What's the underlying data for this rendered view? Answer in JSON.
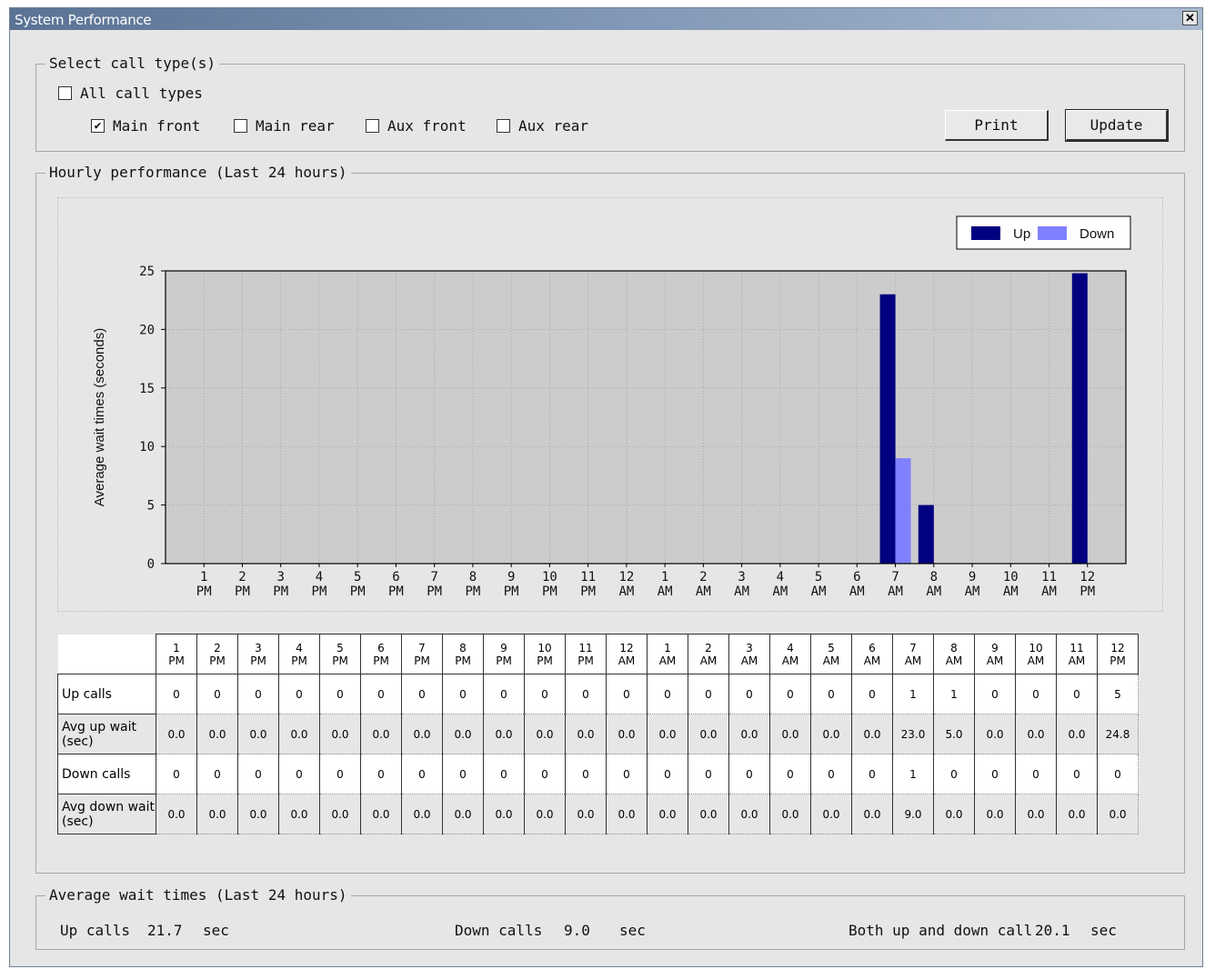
{
  "window": {
    "title": "System Performance",
    "close_glyph": "✕"
  },
  "call_types": {
    "legend": "Select call type(s)",
    "all": {
      "label": "All call types",
      "checked": false
    },
    "options": [
      {
        "label": "Main front",
        "checked": true
      },
      {
        "label": "Main rear",
        "checked": false
      },
      {
        "label": "Aux front",
        "checked": false
      },
      {
        "label": "Aux rear",
        "checked": false
      }
    ]
  },
  "buttons": {
    "print": "Print",
    "update": "Update"
  },
  "hourly": {
    "legend": "Hourly performance (Last 24 hours)"
  },
  "chart_data": {
    "type": "bar",
    "ylabel": "Average wait times (seconds)",
    "xlabel": "",
    "ylim": [
      0,
      25
    ],
    "yticks": [
      0,
      5,
      10,
      15,
      20,
      25
    ],
    "categories": [
      "1 PM",
      "2 PM",
      "3 PM",
      "4 PM",
      "5 PM",
      "6 PM",
      "7 PM",
      "8 PM",
      "9 PM",
      "10 PM",
      "11 PM",
      "12 AM",
      "1 AM",
      "2 AM",
      "3 AM",
      "4 AM",
      "5 AM",
      "6 AM",
      "7 AM",
      "8 AM",
      "9 AM",
      "10 AM",
      "11 AM",
      "12 PM"
    ],
    "series": [
      {
        "name": "Up",
        "color": "#000080",
        "values": [
          0,
          0,
          0,
          0,
          0,
          0,
          0,
          0,
          0,
          0,
          0,
          0,
          0,
          0,
          0,
          0,
          0,
          0,
          23.0,
          5.0,
          0,
          0,
          0,
          24.8
        ]
      },
      {
        "name": "Down",
        "color": "#8080ff",
        "values": [
          0,
          0,
          0,
          0,
          0,
          0,
          0,
          0,
          0,
          0,
          0,
          0,
          0,
          0,
          0,
          0,
          0,
          0,
          9.0,
          0,
          0,
          0,
          0,
          0
        ]
      }
    ],
    "grid": true,
    "legend_position": "top-right",
    "plot_background": "#cccccc"
  },
  "table": {
    "rows": [
      {
        "label": "Up calls",
        "values": [
          "0",
          "0",
          "0",
          "0",
          "0",
          "0",
          "0",
          "0",
          "0",
          "0",
          "0",
          "0",
          "0",
          "0",
          "0",
          "0",
          "0",
          "0",
          "1",
          "1",
          "0",
          "0",
          "0",
          "5"
        ]
      },
      {
        "label": "Avg up wait (sec)",
        "values": [
          "0.0",
          "0.0",
          "0.0",
          "0.0",
          "0.0",
          "0.0",
          "0.0",
          "0.0",
          "0.0",
          "0.0",
          "0.0",
          "0.0",
          "0.0",
          "0.0",
          "0.0",
          "0.0",
          "0.0",
          "0.0",
          "23.0",
          "5.0",
          "0.0",
          "0.0",
          "0.0",
          "24.8"
        ]
      },
      {
        "label": "Down calls",
        "values": [
          "0",
          "0",
          "0",
          "0",
          "0",
          "0",
          "0",
          "0",
          "0",
          "0",
          "0",
          "0",
          "0",
          "0",
          "0",
          "0",
          "0",
          "0",
          "1",
          "0",
          "0",
          "0",
          "0",
          "0"
        ]
      },
      {
        "label": "Avg down wait (sec)",
        "values": [
          "0.0",
          "0.0",
          "0.0",
          "0.0",
          "0.0",
          "0.0",
          "0.0",
          "0.0",
          "0.0",
          "0.0",
          "0.0",
          "0.0",
          "0.0",
          "0.0",
          "0.0",
          "0.0",
          "0.0",
          "0.0",
          "9.0",
          "0.0",
          "0.0",
          "0.0",
          "0.0",
          "0.0"
        ]
      }
    ]
  },
  "averages": {
    "legend": "Average wait times (Last 24 hours)",
    "up_label": "Up calls",
    "up_value": "21.7",
    "up_unit": "sec",
    "down_label": "Down calls",
    "down_value": "9.0",
    "down_unit": "sec",
    "both_label": "Both up and down call",
    "both_value": "20.1",
    "both_unit": "sec"
  }
}
